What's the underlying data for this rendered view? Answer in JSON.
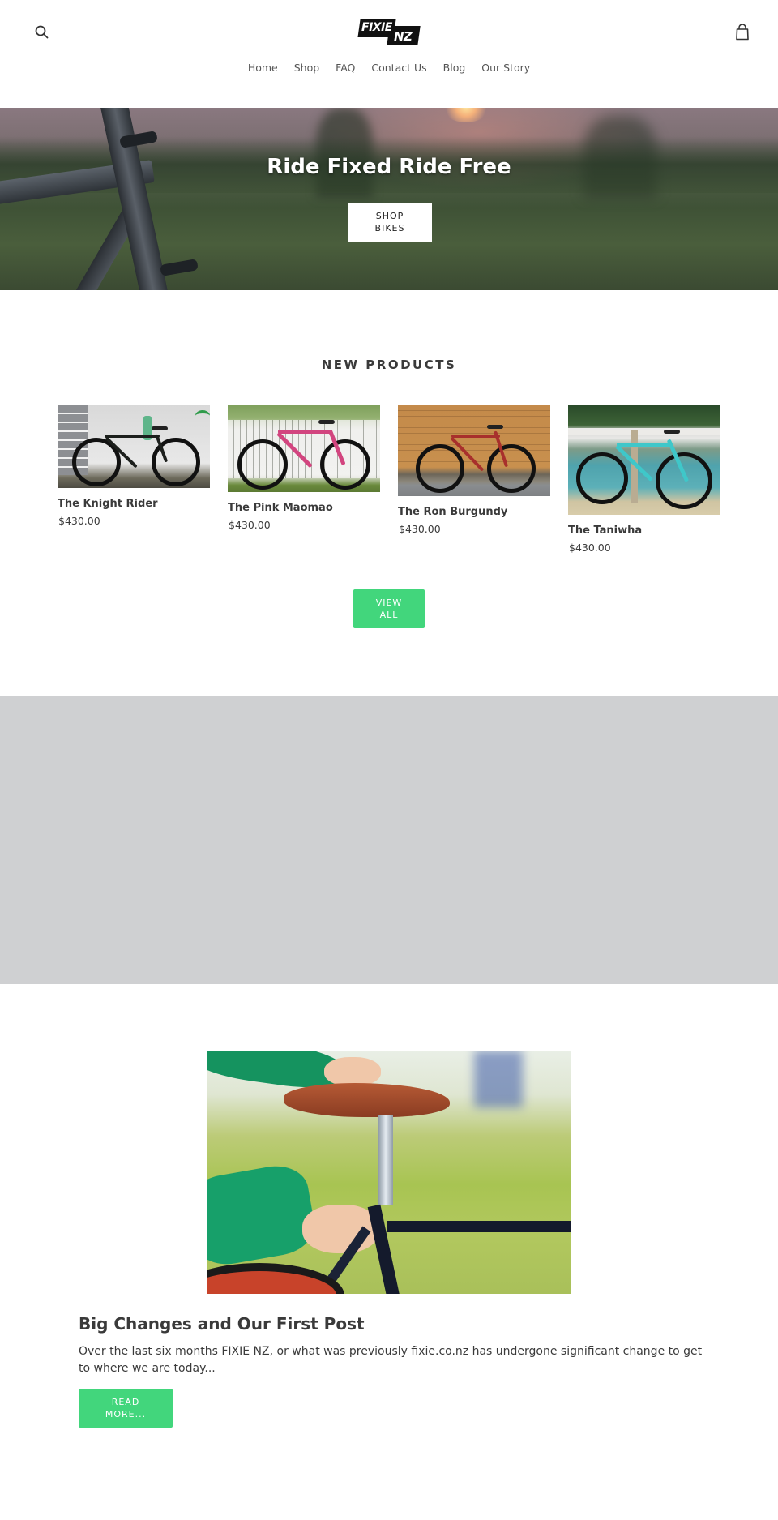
{
  "header": {
    "logo": {
      "line1": "FIXIE",
      "line2": "NZ"
    },
    "search_icon": "search-icon",
    "cart_icon": "shopping-bag-icon",
    "nav": [
      {
        "label": "Home"
      },
      {
        "label": "Shop"
      },
      {
        "label": "FAQ"
      },
      {
        "label": "Contact Us"
      },
      {
        "label": "Blog"
      },
      {
        "label": "Our Story"
      }
    ]
  },
  "hero": {
    "title": "Ride Fixed Ride Free",
    "button_label": "Shop Bikes"
  },
  "new_products": {
    "title": "New Products",
    "items": [
      {
        "name": "The Knight Rider",
        "price": "$430.00",
        "frame_color": "#1c1f1c"
      },
      {
        "name": "The Pink Maomao",
        "price": "$430.00",
        "frame_color": "#d2457f"
      },
      {
        "name": "The Ron Burgundy",
        "price": "$430.00",
        "frame_color": "#a8302c"
      },
      {
        "name": "The Taniwha",
        "price": "$430.00",
        "frame_color": "#3fc7c9"
      }
    ],
    "view_all_label": "View All"
  },
  "blog": {
    "title": "Big Changes and Our First Post",
    "excerpt": "Over the last six months FIXIE NZ, or what was previously fixie.co.nz has undergone significant change to get to where we are today...",
    "button_label": "Read More..."
  },
  "colors": {
    "accent": "#42d67c",
    "text": "#3a3a3a",
    "placeholder_block": "#cfd0d2"
  }
}
